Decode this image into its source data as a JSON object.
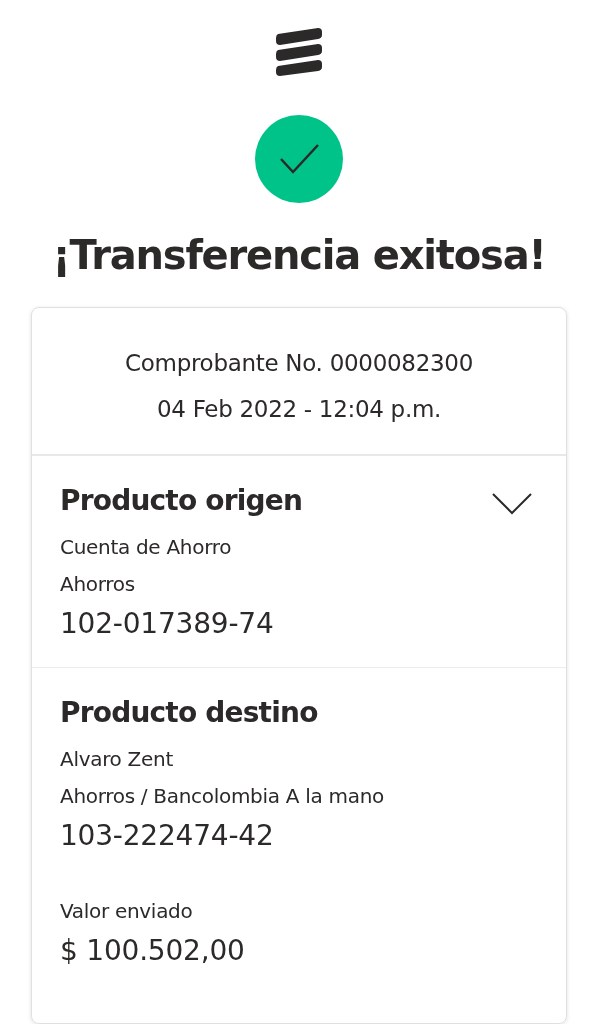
{
  "status": {
    "title": "¡Transferencia exitosa!",
    "success": true
  },
  "receipt": {
    "number": "Comprobante No. 0000082300",
    "datetime": "04 Feb 2022 - 12:04 p.m."
  },
  "sections": [
    {
      "title": "Producto origen",
      "expandable": true,
      "lines": [
        "Cuenta de Ahorro",
        "Ahorros"
      ],
      "account": "102-017389-74"
    },
    {
      "title": "Producto destino",
      "expandable": false,
      "lines": [
        "Alvaro Zent",
        "Ahorros / Bancolombia A la mano"
      ],
      "account": "103-222474-42",
      "amount_label": "Valor enviado",
      "amount": "$ 100.502,00"
    }
  ]
}
